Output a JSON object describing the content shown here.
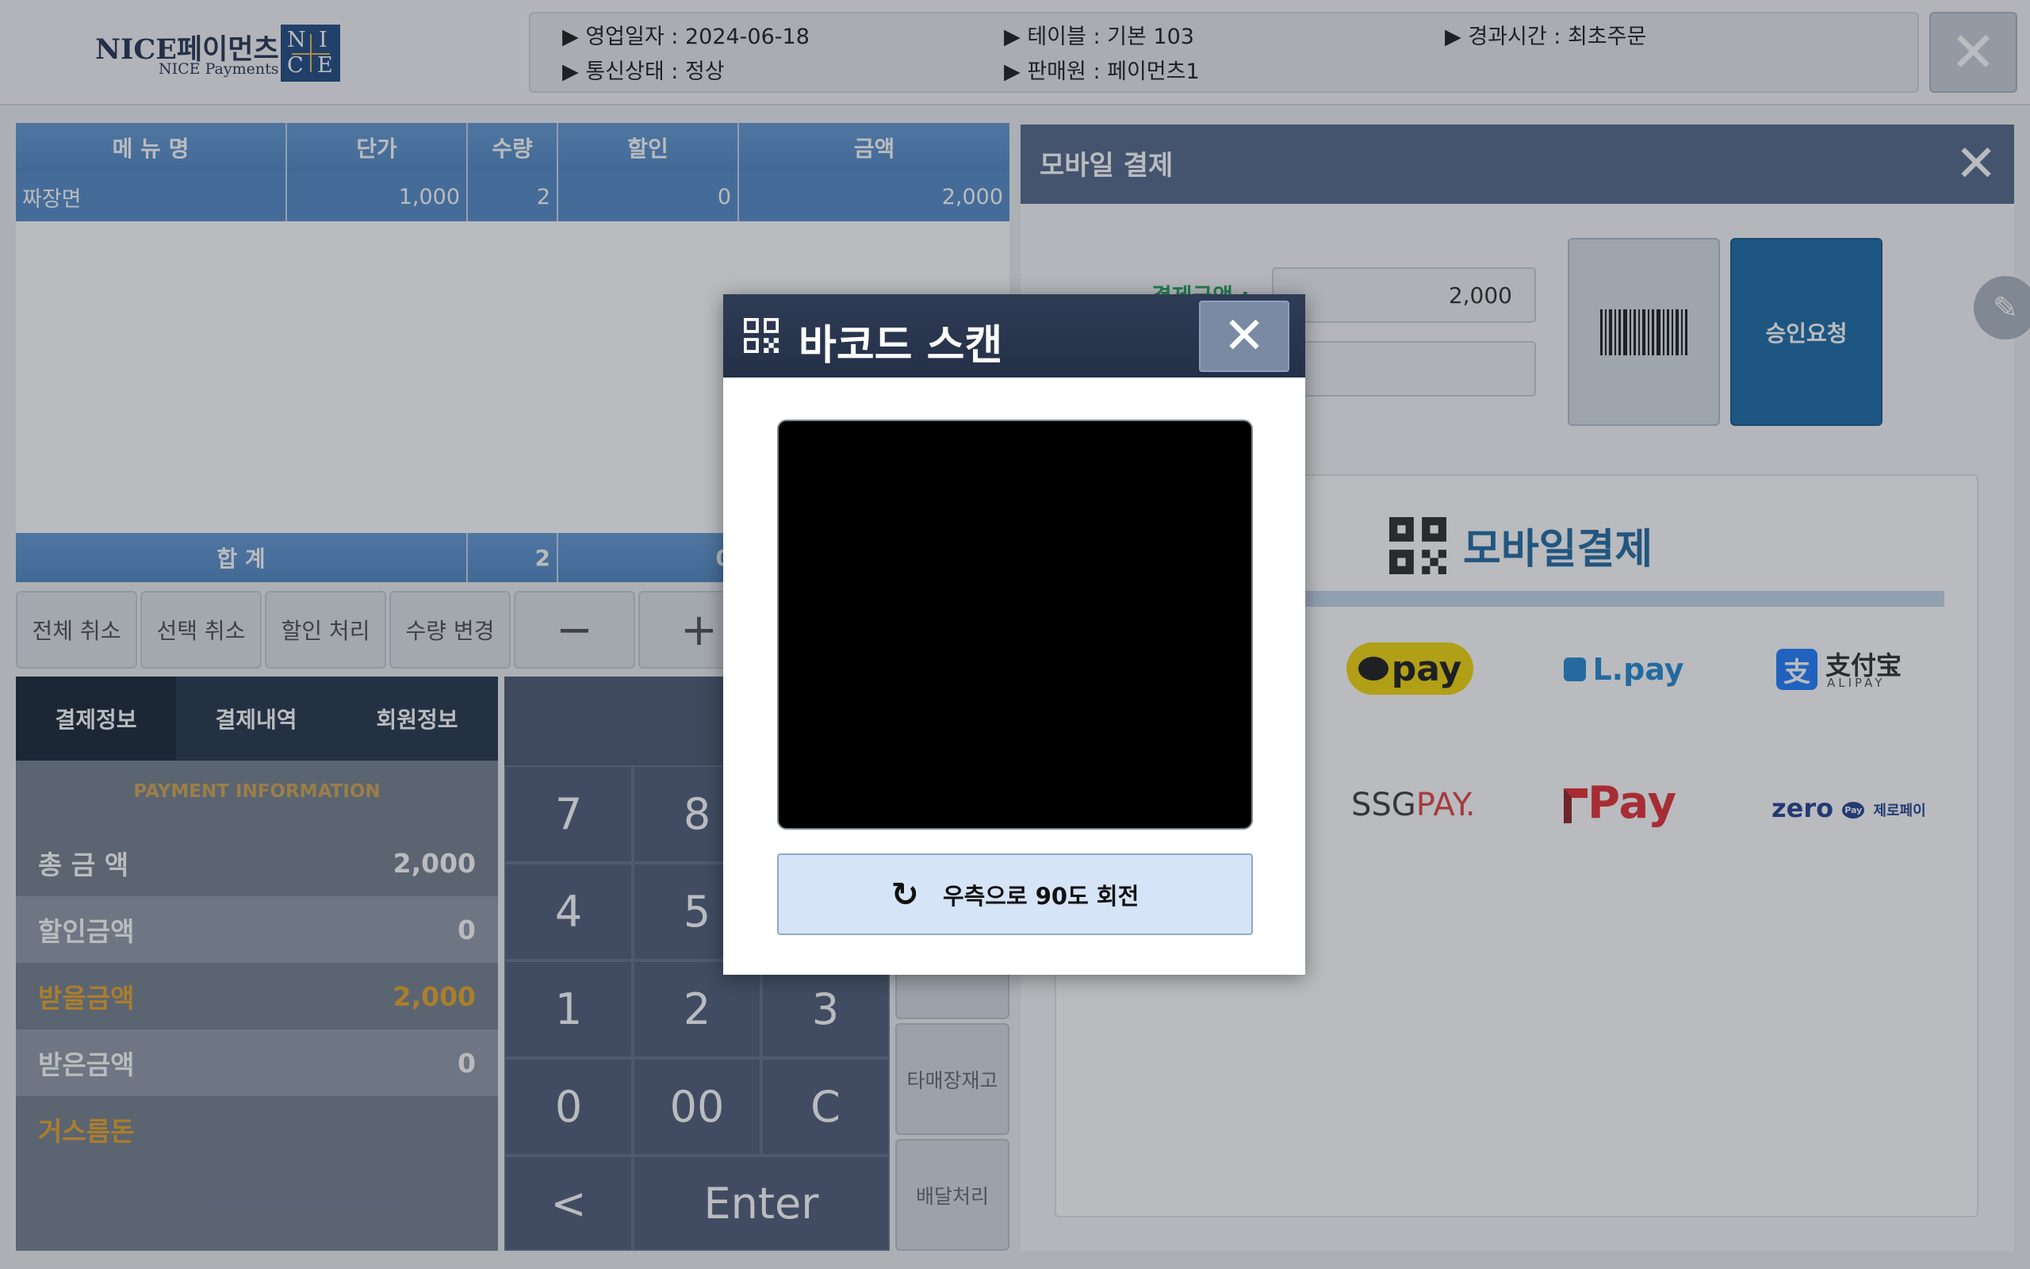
{
  "header": {
    "logo_ko": "NICE페이먼츠",
    "logo_en": "NICE Payments",
    "logo_box": {
      "n": "N",
      "i": "I",
      "c": "C",
      "e": "E"
    },
    "info": {
      "business_date": "▶ 영업일자 : 2024-06-18",
      "table": "▶ 테이블 : 기본 103",
      "elapsed": "▶ 경과시간 : 최초주문",
      "comm_status": "▶ 통신상태 : 정상",
      "seller": "▶ 판매원 : 페이먼츠1"
    },
    "close_glyph": "✕"
  },
  "order_table": {
    "columns": [
      "메 뉴 명",
      "단가",
      "수량",
      "할인",
      "금액"
    ],
    "rows": [
      {
        "name": "짜장면",
        "price": "1,000",
        "qty": "2",
        "discount": "0",
        "amount": "2,000"
      }
    ],
    "total_label": "합 계",
    "total_qty": "2",
    "total_discount": "0"
  },
  "actions": {
    "cancel_all": "전체 취소",
    "cancel_selected": "선택 취소",
    "discount": "할인 처리",
    "change_qty": "수량 변경",
    "minus": "−",
    "plus": "+"
  },
  "payment_panel": {
    "tabs": [
      "결제정보",
      "결제내역",
      "회원정보"
    ],
    "title": "PAYMENT INFORMATION",
    "rows": [
      {
        "label": "총 금 액",
        "value": "2,000"
      },
      {
        "label": "할인금액",
        "value": "0"
      },
      {
        "label": "받을금액",
        "value": "2,000"
      },
      {
        "label": "받은금액",
        "value": "0"
      },
      {
        "label": "거스름돈",
        "value": ""
      }
    ]
  },
  "keypad": {
    "keys": [
      "7",
      "8",
      "4",
      "5",
      "1",
      "2",
      "3",
      "0",
      "00",
      "C",
      "<",
      "Enter"
    ],
    "side": [
      "타매장재고",
      "배달처리"
    ]
  },
  "mobile_pay": {
    "header": "모바일 결제",
    "close_glyph": "✕",
    "amount_label": "결제금액 :",
    "amount": "2,000",
    "approve": "승인요청",
    "title": "모바일결제",
    "providers": {
      "kakaopay": "pay",
      "lpay": "L.pay",
      "alipay_cn": "支付宝",
      "alipay_en": "ALIPAY",
      "ssgpay_a": "SSG",
      "ssgpay_b": "PAY.",
      "tpay": "Pay",
      "zero": "zero",
      "zero_pay": "Pay",
      "zero_ko": "제로페이"
    },
    "edit_glyph": "✎"
  },
  "modal": {
    "title": "바코드 스캔",
    "close_glyph": "✕",
    "rotate_label": "우측으로 90도 회전",
    "rotate_glyph": "↻"
  },
  "colors": {
    "header_blue": "#4a82c1",
    "navy": "#1b2c43",
    "accent_orange": "#d2a24a",
    "mobile_blue": "#17659e",
    "approve_blue": "#1165a3"
  }
}
